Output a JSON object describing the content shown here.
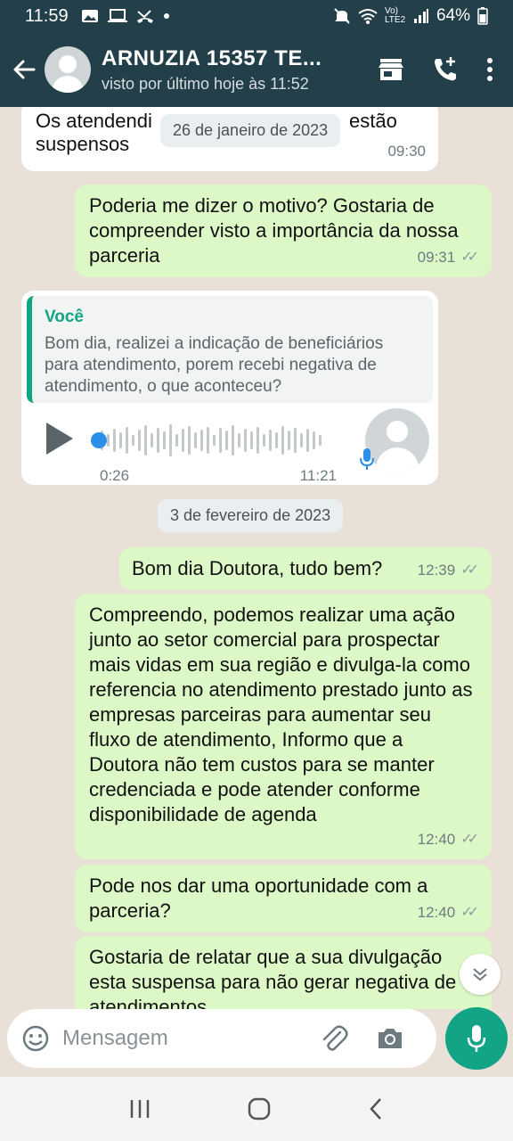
{
  "status_bar": {
    "time": "11:59",
    "battery": "64%",
    "network": "Vo) LTE2"
  },
  "header": {
    "title": "ARNUZIA 15357 TE...",
    "subtitle": "visto por último hoje às 11:52"
  },
  "messages": {
    "m1": {
      "text_a": "Os atendendi",
      "text_b": "estão",
      "text_c": "suspensos",
      "time": "09:30"
    },
    "date1": "26 de janeiro de 2023",
    "m2": {
      "text": "Poderia me dizer o motivo? Gostaria de compreender visto a importância da nossa parceria",
      "time": "09:31"
    },
    "m3": {
      "quote_author": "Você",
      "quote_text": "Bom dia, realizei a indicação de beneficiários para atendimento, porem recebi negativa de atendimento, o que aconteceu?",
      "audio_duration": "0:26",
      "time": "11:21"
    },
    "date2": "3 de fevereiro de 2023",
    "m4": {
      "text": "Bom dia Doutora, tudo bem?",
      "time": "12:39"
    },
    "m5": {
      "text": "Compreendo, podemos realizar uma ação junto ao setor comercial para prospectar mais vidas em sua região e divulga-la como referencia no atendimento prestado junto as empresas parceiras para aumentar seu fluxo de atendimento, Informo que a Doutora não tem custos para se manter credenciada e pode atender conforme disponibilidade de agenda",
      "time": "12:40"
    },
    "m6": {
      "text": "Pode nos dar uma oportunidade com a parceria?",
      "time": "12:40"
    },
    "m7": {
      "text": "Gostaria de relatar que a sua divulgação esta suspensa para não gerar negativa de atendimentos"
    }
  },
  "composer": {
    "placeholder": "Mensagem"
  },
  "colors": {
    "header": "#233f49",
    "accent": "#12a484",
    "outgoing": "#dcf8c6",
    "background": "#e9e1d8"
  }
}
